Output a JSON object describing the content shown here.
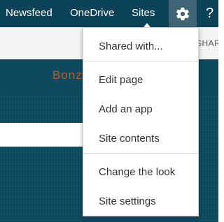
{
  "suitebar": {
    "links": [
      "Newsfeed",
      "OneDrive",
      "Sites"
    ],
    "settings_icon": "gear-icon",
    "help_icon": "help-icon",
    "help_glyph": "?"
  },
  "sharebar": {
    "share_label": "SHARE"
  },
  "site": {
    "title": "Bonz"
  },
  "settings_menu": {
    "items": [
      "Shared with...",
      "Edit page",
      "Add an app",
      "Site contents",
      "Change the look",
      "Site settings"
    ]
  },
  "colors": {
    "suitebar_bg": "#0c4258",
    "header_bg": "#0d4a5e",
    "site_title": "#c9552d"
  }
}
